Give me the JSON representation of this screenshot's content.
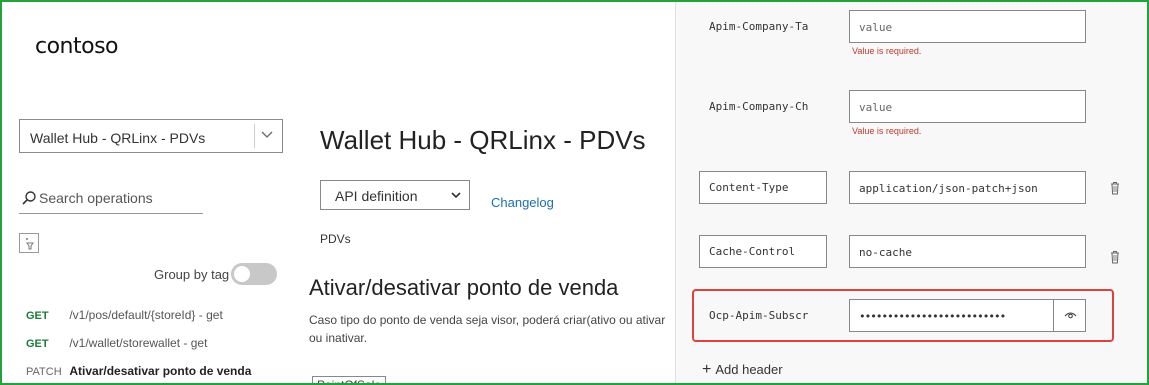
{
  "brand": {
    "logo": "contoso"
  },
  "sidebar": {
    "api_selected": "Wallet Hub - QRLinx - PDVs",
    "search_placeholder": "Search operations",
    "group_by_label": "Group by tag",
    "operations": [
      {
        "method": "GET",
        "path": "/v1/pos/default/{storeId} - get"
      },
      {
        "method": "GET",
        "path": "/v1/wallet/storewallet - get"
      },
      {
        "method": "PATCH",
        "path": "Ativar/desativar ponto de venda"
      }
    ]
  },
  "main": {
    "title": "Wallet Hub - QRLinx - PDVs",
    "definition_select": "API definition",
    "changelog": "Changelog",
    "tag": "PDVs",
    "operation_title": "Ativar/desativar ponto de venda",
    "operation_description": "Caso tipo do ponto de venda seja visor, poderá criar(ativo ou ativar ou inativar.",
    "pos_tag": "PointOfSale"
  },
  "headers_panel": {
    "rows": [
      {
        "name": "Apim-Company-Ta",
        "value": "value",
        "placeholder": true,
        "error": "Value is required."
      },
      {
        "name": "Apim-Company-Ch",
        "value": "value",
        "placeholder": true,
        "error": "Value is required."
      },
      {
        "name": "Content-Type",
        "value": "application/json-patch+json"
      },
      {
        "name": "Cache-Control",
        "value": "no-cache"
      },
      {
        "name": "Ocp-Apim-Subscr",
        "value": "••••••••••••••••••••••••••"
      }
    ],
    "add_header": "Add header"
  },
  "colors": {
    "frame": "#22a33a",
    "highlight": "#e0413a",
    "link": "#1a6db5",
    "error": "#c0392b"
  }
}
